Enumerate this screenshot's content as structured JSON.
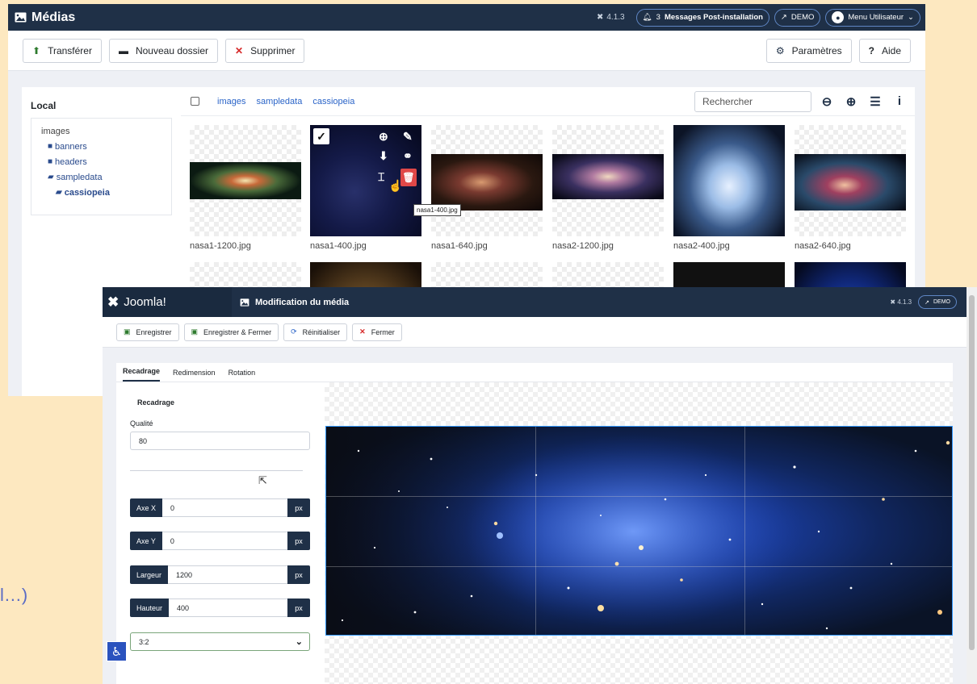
{
  "back": {
    "title": "Médias",
    "version": "4.1.3",
    "notif_count": "3",
    "messages_label": "Messages Post-installation",
    "demo_label": "DEMO",
    "user_menu_label": "Menu Utilisateur",
    "toolbar": {
      "upload": "Transférer",
      "new_folder": "Nouveau dossier",
      "delete": "Supprimer",
      "settings": "Paramètres",
      "help": "Aide"
    },
    "sidebar": {
      "section": "Local",
      "root": "images",
      "folders": [
        "banners",
        "headers",
        "sampledata"
      ],
      "subfolder": "cassiopeia"
    },
    "breadcrumbs": [
      "images",
      "sampledata",
      "cassiopeia"
    ],
    "search_placeholder": "Rechercher",
    "files": [
      "nasa1-1200.jpg",
      "nasa1-400.jpg",
      "nasa1-640.jpg",
      "nasa2-1200.jpg",
      "nasa2-400.jpg",
      "nasa2-640.jpg"
    ],
    "tooltip": "nasa1-400.jpg"
  },
  "front": {
    "brand": "Joomla!",
    "title": "Modification du média",
    "version": "4.1.3",
    "demo_label": "DEMO",
    "toolbar": {
      "save": "Enregistrer",
      "save_close": "Enregistrer & Fermer",
      "reset": "Réinitialiser",
      "close": "Fermer"
    },
    "tabs": [
      "Recadrage",
      "Redimension",
      "Rotation"
    ],
    "form": {
      "section_title": "Recadrage",
      "quality_label": "Qualité",
      "quality_value": "80",
      "x_label": "Axe X",
      "x_value": "0",
      "y_label": "Axe Y",
      "y_value": "0",
      "width_label": "Largeur",
      "width_value": "1200",
      "height_label": "Hauteur",
      "height_value": "400",
      "unit": "px",
      "ratio": "3:2"
    }
  },
  "side_text": "l…)",
  "colors": {
    "header": "#1f3047",
    "accent": "#2a64c8",
    "delete": "#d62828",
    "background": "#fde8c0"
  }
}
